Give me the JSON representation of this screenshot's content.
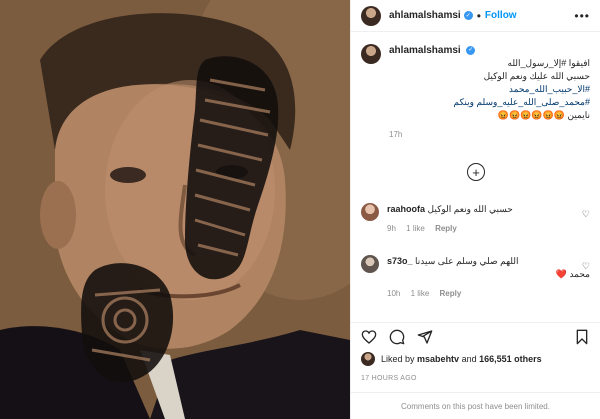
{
  "post": {
    "username": "ahlamalshamsi",
    "follow_label": "Follow",
    "more_label": "•••",
    "caption_lines": [
      "افيقوا #إلا_رسول_الله",
      "حسبي الله عليك ونعم الوكيل",
      "#الا_حبيب_الله_محمد",
      "#محمد_صلى_الله_عليه_وسلم وينكم",
      "نايمين 😡😡😡😡😡😡"
    ],
    "caption_time": "17h"
  },
  "comments": [
    {
      "username": "raahoofa",
      "text": "حسبي الله ونعم الوكيل",
      "time": "9h",
      "likes": "1 like",
      "reply": "Reply"
    },
    {
      "username": "s73o_",
      "text": "اللهم صلي وسلم على سيدنا",
      "text2": "محمد ❤️",
      "time": "10h",
      "likes": "1 like",
      "reply": "Reply"
    }
  ],
  "likes_line": {
    "prefix": "Liked by",
    "user": "msabehtv",
    "middle": "and",
    "count": "166,551 others"
  },
  "posted_ago": "17 HOURS AGO",
  "comments_limited": "Comments on this post have been limited.",
  "icons": [
    "heart-icon",
    "comment-icon",
    "share-icon",
    "bookmark-icon",
    "plus-circle-icon",
    "verified-badge-icon"
  ],
  "colors": {
    "link": "#0095f6",
    "hashtag": "#00376b",
    "meta": "#8e8e8e",
    "verified": "#3897f0"
  }
}
